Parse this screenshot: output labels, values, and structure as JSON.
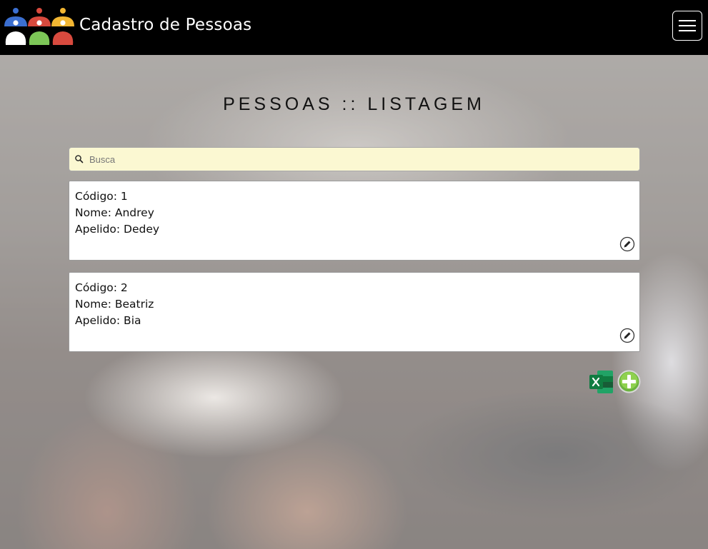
{
  "app": {
    "title": "Cadastro de Pessoas",
    "logo_icon": "people-group-logo",
    "menu_icon": "hamburger-menu-icon"
  },
  "page": {
    "heading": "PESSOAS :: LISTAGEM"
  },
  "search": {
    "placeholder": "Busca",
    "value": "",
    "icon": "search-icon",
    "background": "#fbf8d2"
  },
  "people": [
    {
      "codigo_label": "Código: 1",
      "nome_label": "Nome: Andrey",
      "apelido_label": "Apelido: Dedey"
    },
    {
      "codigo_label": "Código: 2",
      "nome_label": "Nome: Beatriz",
      "apelido_label": "Apelido: Bia"
    }
  ],
  "actions": {
    "export_icon": "excel-export-icon",
    "add_icon": "add-plus-icon",
    "edit_icon": "edit-pencil-icon"
  },
  "colors": {
    "navbar": "#000000",
    "excel_green": "#1d7044",
    "add_green": "#7cc242"
  }
}
